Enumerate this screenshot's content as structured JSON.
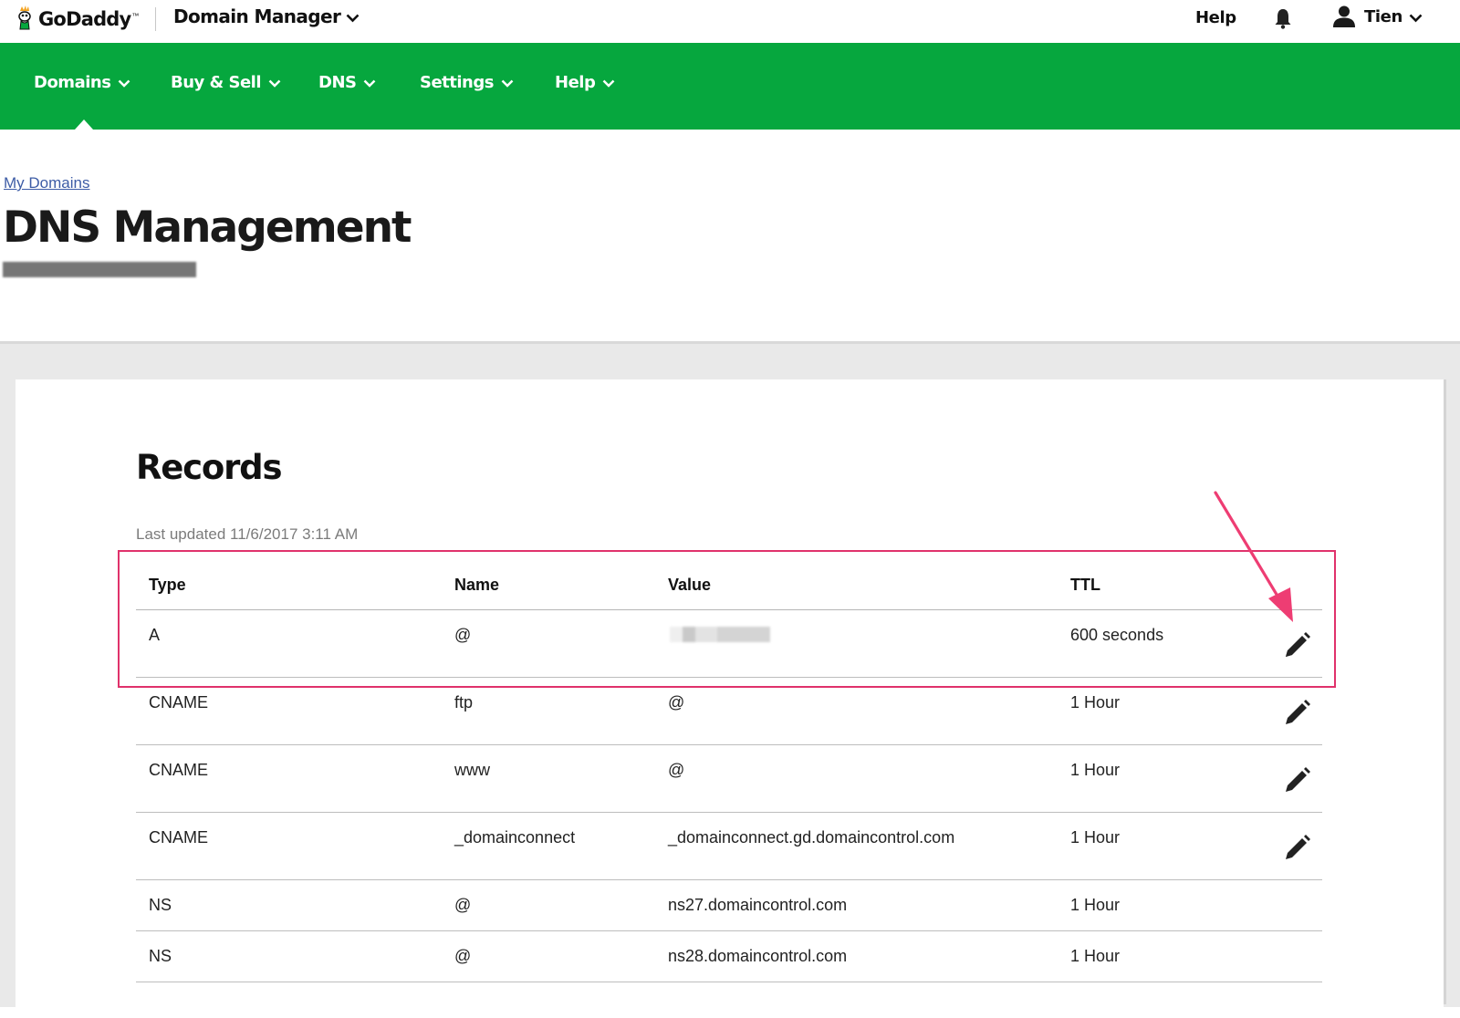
{
  "topbar": {
    "brand": "GoDaddy",
    "brand_tm": "™",
    "app_name": "Domain Manager",
    "help_label": "Help",
    "user_name": "Tien",
    "icons": [
      "godaddy-logo-icon",
      "chevron-down-icon",
      "bell-icon",
      "user-icon"
    ]
  },
  "nav": {
    "items": [
      {
        "label": "Domains"
      },
      {
        "label": "Buy & Sell"
      },
      {
        "label": "DNS"
      },
      {
        "label": "Settings"
      },
      {
        "label": "Help"
      }
    ],
    "active": "Domains",
    "background_color": "#06a73e"
  },
  "breadcrumb": "My Domains",
  "page_title": "DNS Management",
  "records": {
    "title": "Records",
    "last_updated": "Last updated 11/6/2017 3:11 AM",
    "columns": [
      "Type",
      "Name",
      "Value",
      "TTL"
    ],
    "rows": [
      {
        "type": "A",
        "name": "@",
        "value": "",
        "ttl": "600 seconds",
        "editable": true,
        "value_redacted": true
      },
      {
        "type": "CNAME",
        "name": "ftp",
        "value": "@",
        "ttl": "1 Hour",
        "editable": true
      },
      {
        "type": "CNAME",
        "name": "www",
        "value": "@",
        "ttl": "1 Hour",
        "editable": true
      },
      {
        "type": "CNAME",
        "name": "_domainconnect",
        "value": "_domainconnect.gd.domaincontrol.com",
        "ttl": "1 Hour",
        "editable": true
      },
      {
        "type": "NS",
        "name": "@",
        "value": "ns27.domaincontrol.com",
        "ttl": "1 Hour",
        "editable": false
      },
      {
        "type": "NS",
        "name": "@",
        "value": "ns28.domaincontrol.com",
        "ttl": "1 Hour",
        "editable": false
      }
    ]
  },
  "annotation": {
    "color": "#e0326b",
    "highlighted_row": 0,
    "arrow_target": "edit-icon"
  }
}
